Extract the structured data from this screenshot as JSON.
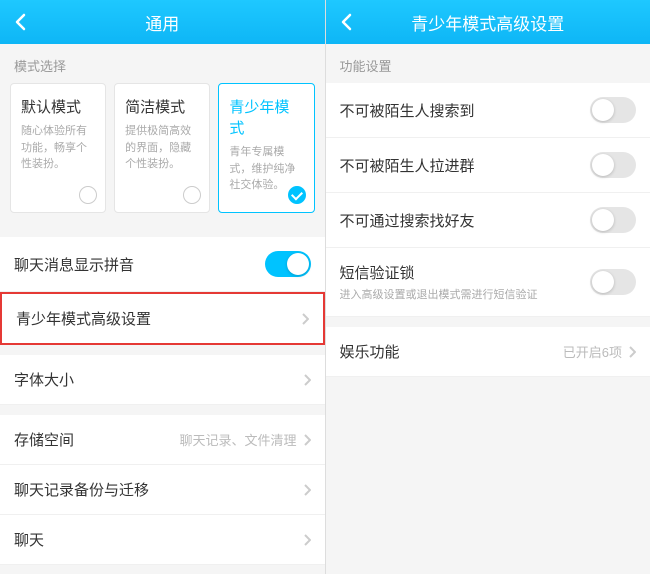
{
  "left": {
    "header_title": "通用",
    "section_mode_label": "模式选择",
    "modes": [
      {
        "title": "默认模式",
        "desc": "随心体验所有功能，畅享个性装扮。",
        "selected": false
      },
      {
        "title": "简洁模式",
        "desc": "提供极简高效的界面，隐藏个性装扮。",
        "selected": false
      },
      {
        "title": "青少年模式",
        "desc": "青年专属模式，维护纯净社交体验。",
        "selected": true
      }
    ],
    "row_pinyin": "聊天消息显示拼音",
    "row_youth_adv": "青少年模式高级设置",
    "row_font": "字体大小",
    "row_storage": "存储空间",
    "row_storage_hint": "聊天记录、文件清理",
    "row_backup": "聊天记录备份与迁移",
    "row_chat": "聊天"
  },
  "right": {
    "header_title": "青少年模式高级设置",
    "section_func_label": "功能设置",
    "row_search_stranger": "不可被陌生人搜索到",
    "row_pull_group": "不可被陌生人拉进群",
    "row_find_friend": "不可通过搜索找好友",
    "row_sms_lock": "短信验证锁",
    "row_sms_lock_desc": "进入高级设置或退出模式需进行短信验证",
    "row_entertainment": "娱乐功能",
    "row_entertainment_hint": "已开启6项"
  }
}
